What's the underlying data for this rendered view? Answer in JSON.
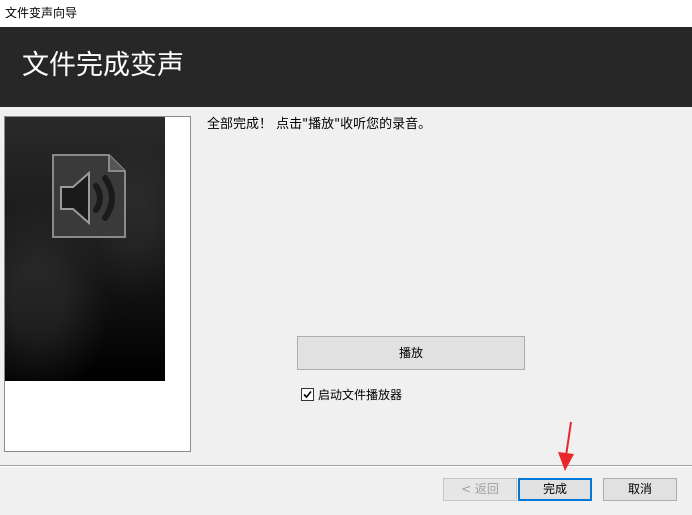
{
  "window": {
    "title": "文件变声向导"
  },
  "banner": {
    "title": "文件完成变声"
  },
  "content": {
    "message": "全部完成！ 点击\"播放\"收听您的录音。",
    "play_label": "播放",
    "launch_player_label": "启动文件播放器",
    "launch_player_checked": true
  },
  "footer": {
    "back_label": "< 返回",
    "finish_label": "完成",
    "cancel_label": "取消"
  },
  "colors": {
    "banner_bg": "#272727",
    "focus_border": "#0078d7",
    "annotation_arrow": "#e8262b"
  },
  "icons": {
    "sidebar": "speaker-document-icon",
    "checkbox": "checkmark-icon",
    "annotation": "red-arrow-icon"
  }
}
